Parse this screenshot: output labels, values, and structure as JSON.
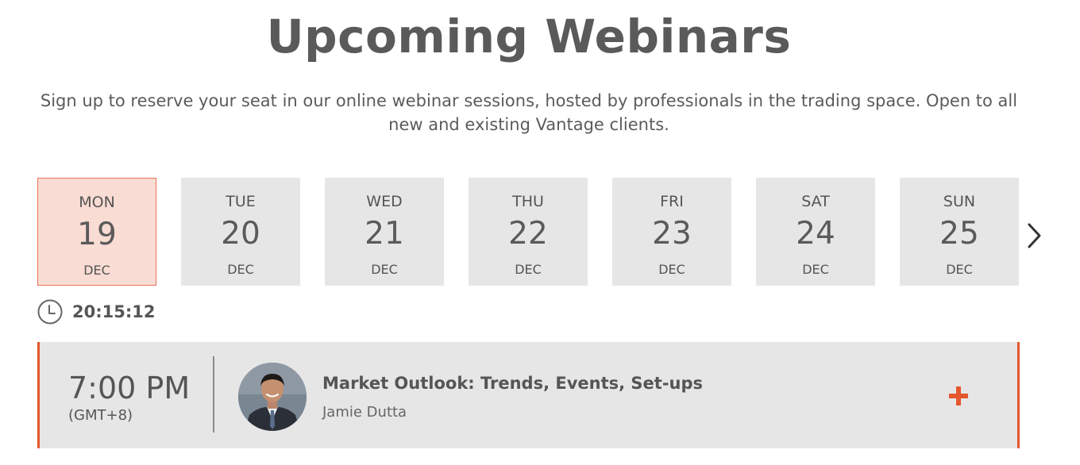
{
  "header": {
    "title": "Upcoming Webinars",
    "subtitle": "Sign up to reserve your seat in our online webinar sessions, hosted by professionals in the trading space. Open to all new and existing Vantage clients."
  },
  "days": [
    {
      "dow": "MON",
      "day": "19",
      "month": "DEC",
      "selected": true
    },
    {
      "dow": "TUE",
      "day": "20",
      "month": "DEC",
      "selected": false
    },
    {
      "dow": "WED",
      "day": "21",
      "month": "DEC",
      "selected": false
    },
    {
      "dow": "THU",
      "day": "22",
      "month": "DEC",
      "selected": false
    },
    {
      "dow": "FRI",
      "day": "23",
      "month": "DEC",
      "selected": false
    },
    {
      "dow": "SAT",
      "day": "24",
      "month": "DEC",
      "selected": false
    },
    {
      "dow": "SUN",
      "day": "25",
      "month": "DEC",
      "selected": false
    }
  ],
  "clock": {
    "time": "20:15:12",
    "icon": "clock-icon"
  },
  "events": [
    {
      "time": "7:00 PM",
      "timezone": "(GMT+8)",
      "title": "Market Outlook: Trends, Events, Set-ups",
      "host": "Jamie Dutta"
    }
  ],
  "icons": {
    "next": "chevron-right-icon",
    "expand": "plus-icon"
  },
  "colors": {
    "accent": "#e5572f",
    "selected_bg": "#f9dcd3",
    "tile_bg": "#e6e6e6",
    "text": "#555555"
  }
}
